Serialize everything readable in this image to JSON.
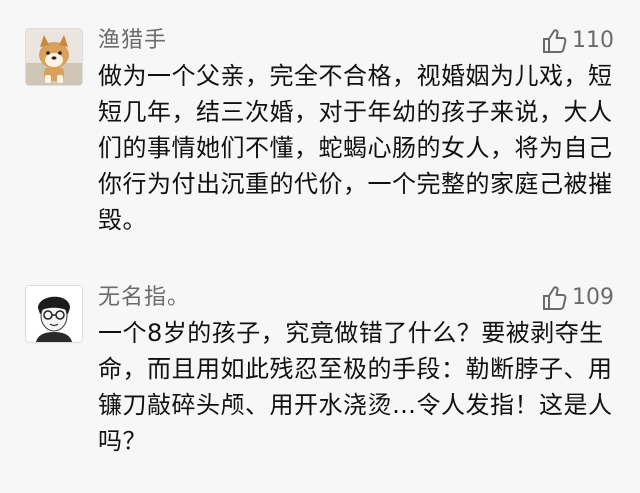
{
  "comments": [
    {
      "username": "渔猎手",
      "likes": "110",
      "avatar_icon": "shiba-dog-avatar",
      "text": "做为一个父亲，完全不合格，视婚姻为儿戏，短短几年，结三次婚，对于年幼的孩子来说，大人们的事情她们不懂，蛇蝎心肠的女人，将为自己你行为付出沉重的代价，一个完整的家庭己被摧毁。"
    },
    {
      "username": "无名指。",
      "likes": "109",
      "avatar_icon": "sketch-portrait-avatar",
      "text": "一个8岁的孩子，究竟做错了什么？要被剥夺生命，而且用如此残忍至极的手段：勒断脖子、用镰刀敲碎头颅、用开水浇烫…令人发指！这是人吗？"
    }
  ],
  "colors": {
    "background": "#f7f7f7",
    "meta_text": "#6b6b6b",
    "body_text": "#111111"
  }
}
